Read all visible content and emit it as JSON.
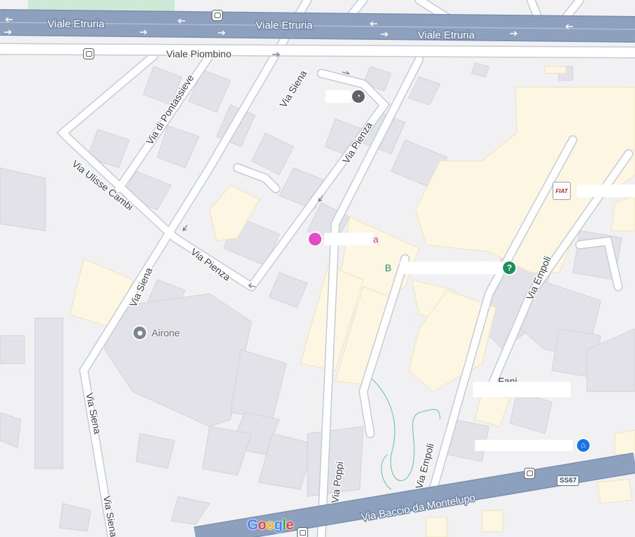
{
  "map": {
    "roads": {
      "viale_etruria": "Viale Etruria",
      "viale_piombino": "Viale Piombino",
      "via_siena": "Via Siena",
      "via_di_pontassieve": "Via di Pontassieve",
      "via_ulisse_cambi": "Via Ulisse Cambi",
      "via_pienza": "Via Pienza",
      "via_empoli": "Via Empoli",
      "via_poppi": "Via Poppi",
      "via_baccio": "Via Baccio da Montelupo",
      "route_shield": "SS67"
    },
    "places": {
      "airone": "Airone",
      "pink_fragment": "a",
      "green_fragment": "B",
      "fani_fragment": "Fani Motors"
    },
    "logos": {
      "shop_logo": "FIAT",
      "google_logo": "Google"
    },
    "colors": {
      "background": "#f1f0f3",
      "major_road": "#8da1bf",
      "minor_road": "#ffffff",
      "road_outline": "#c5cbd6",
      "building": "#e3e2e8",
      "commercial_area": "#fdf6e3",
      "park": "#ceead6",
      "pink_pin": "#e349c8",
      "green_pin": "#1e8e5a",
      "blue_pin": "#1a73e8",
      "gray_pin": "#7c8791"
    },
    "icons": [
      "bus-stop-icon",
      "place-pin-icon",
      "shopping-icon",
      "question-icon",
      "info-icon"
    ]
  }
}
